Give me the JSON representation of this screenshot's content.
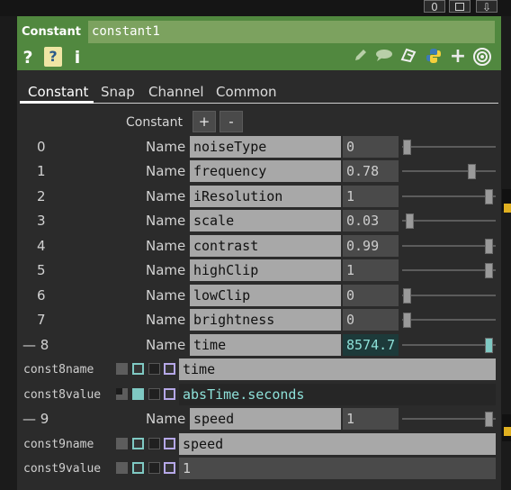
{
  "topbar": {
    "badge": "0",
    "btn_square": "",
    "btn_down": "⇩"
  },
  "header": {
    "op_type": "Constant",
    "op_name": "constant1",
    "help_glyph": "?",
    "python_help_glyph": "?",
    "info_glyph": "i",
    "right_icons": [
      "pencil-icon",
      "comment-icon",
      "clone-icon",
      "python-icon",
      "add-icon",
      "viewer-icon"
    ]
  },
  "tabs": [
    {
      "label": "Constant",
      "active": true
    },
    {
      "label": "Snap"
    },
    {
      "label": "Channel"
    },
    {
      "label": "Common"
    }
  ],
  "sequence": {
    "label": "Constant",
    "add": "+",
    "remove": "-"
  },
  "name_label": "Name",
  "params": [
    {
      "index": "0",
      "name": "noiseType",
      "value": "0",
      "slider": 0.0
    },
    {
      "index": "1",
      "name": "frequency",
      "value": "0.78",
      "slider": 0.78
    },
    {
      "index": "2",
      "name": "iResolution",
      "value": "1",
      "slider": 1.0
    },
    {
      "index": "3",
      "name": "scale",
      "value": "0.03",
      "slider": 0.03
    },
    {
      "index": "4",
      "name": "contrast",
      "value": "0.99",
      "slider": 0.99
    },
    {
      "index": "5",
      "name": "highClip",
      "value": "1",
      "slider": 1.0
    },
    {
      "index": "6",
      "name": "lowClip",
      "value": "0",
      "slider": 0.0
    },
    {
      "index": "7",
      "name": "brightness",
      "value": "0",
      "slider": 0.0
    },
    {
      "index": "— 8",
      "name": "time",
      "value": "8574.7",
      "slider": 1.0
    },
    {
      "index": "— 9",
      "name": "speed",
      "value": "1",
      "slider": 1.0
    }
  ],
  "expr_rows": [
    {
      "label": "const8name",
      "value": "time"
    },
    {
      "label": "const8value",
      "value": "absTime.seconds"
    },
    {
      "label": "const9name",
      "value": "speed"
    },
    {
      "label": "const9value",
      "value": "1"
    }
  ],
  "colors": {
    "header_green": "#51883f",
    "highlight_teal": "#7fc9c3",
    "marker_yellow": "#e0b020"
  }
}
